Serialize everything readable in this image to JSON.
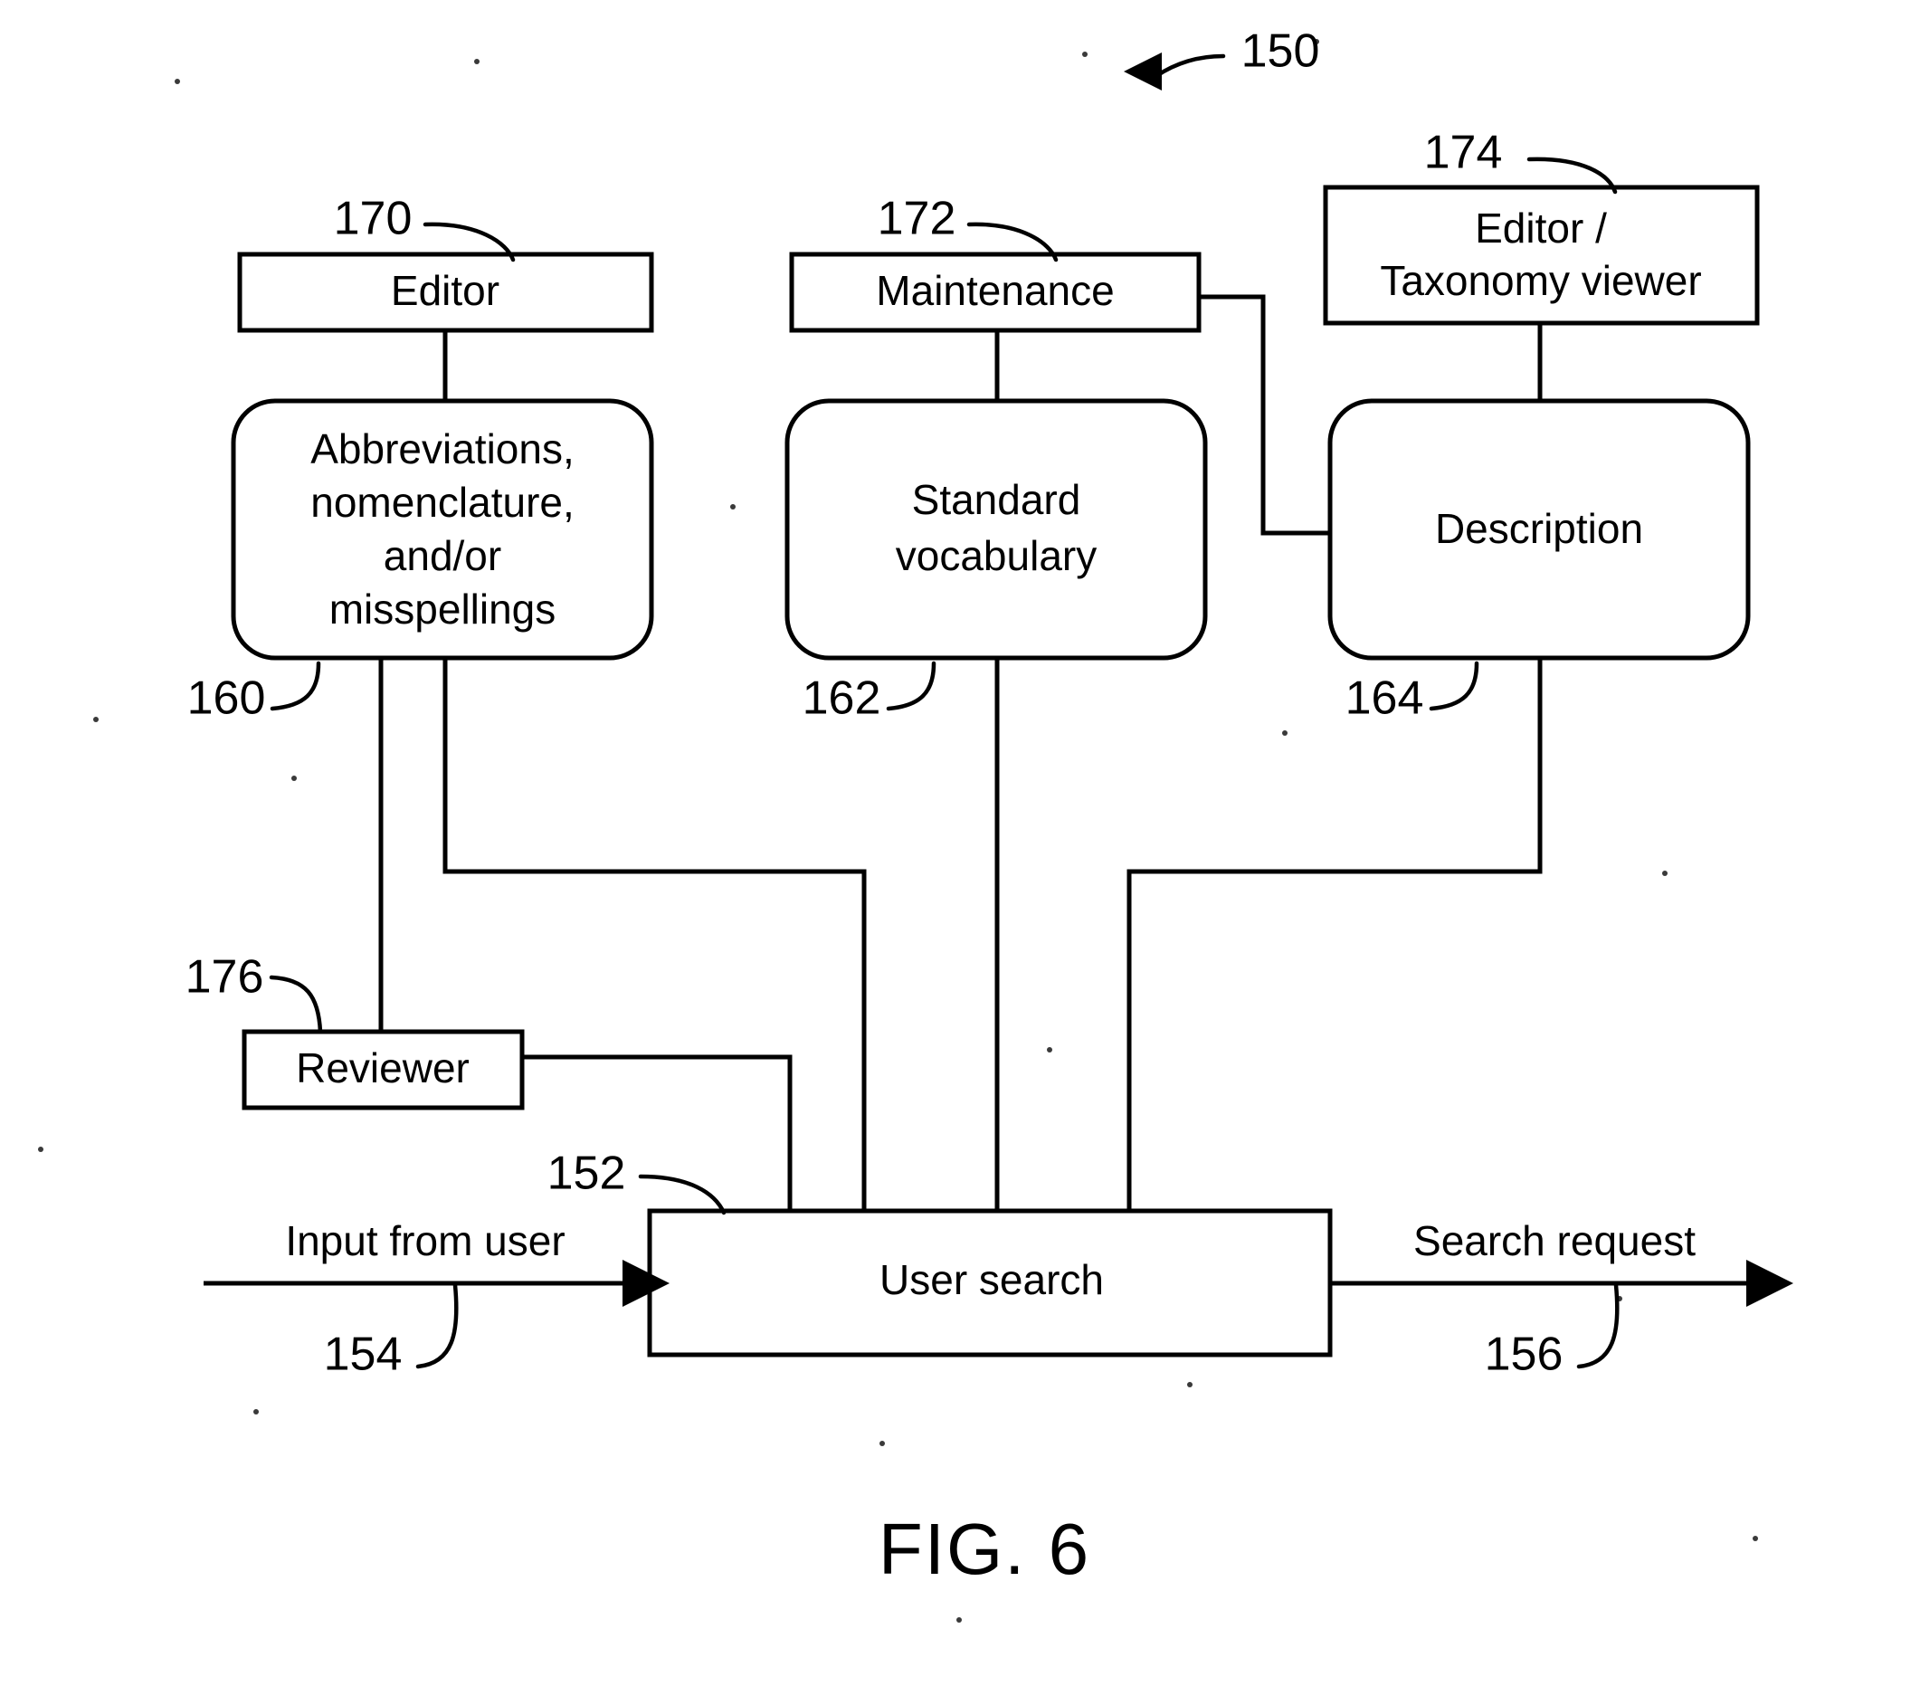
{
  "figure": {
    "caption": "FIG. 6",
    "overall_ref": "150"
  },
  "boxes": {
    "editor": {
      "label": "Editor",
      "ref": "170"
    },
    "maintenance": {
      "label": "Maintenance",
      "ref": "172"
    },
    "editor_taxonomy_viewer": {
      "label_line1": "Editor /",
      "label_line2": "Taxonomy viewer",
      "ref": "174"
    },
    "abbreviations": {
      "label_line1": "Abbreviations,",
      "label_line2": "nomenclature,",
      "label_line3": "and/or",
      "label_line4": "misspellings",
      "ref": "160"
    },
    "standard_vocabulary": {
      "label_line1": "Standard",
      "label_line2": "vocabulary",
      "ref": "162"
    },
    "description": {
      "label": "Description",
      "ref": "164"
    },
    "reviewer": {
      "label": "Reviewer",
      "ref": "176"
    },
    "user_search": {
      "label": "User search",
      "ref": "152"
    }
  },
  "flows": {
    "input": {
      "label": "Input from user",
      "ref": "154"
    },
    "output": {
      "label": "Search request",
      "ref": "156"
    }
  },
  "colors": {
    "ink": "#000000",
    "paper": "#ffffff"
  }
}
